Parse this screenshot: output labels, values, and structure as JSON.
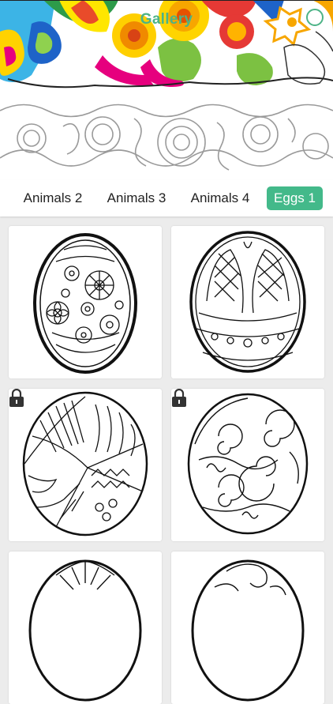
{
  "header": {
    "title": "Gallery"
  },
  "colors": {
    "accent": "#43b98a",
    "title_green": "#4db386"
  },
  "tabs": [
    {
      "label": "Animals 2",
      "active": false
    },
    {
      "label": "Animals 3",
      "active": false
    },
    {
      "label": "Animals 4",
      "active": false
    },
    {
      "label": "Eggs 1",
      "active": true
    }
  ],
  "cards": [
    {
      "pattern": "flowers",
      "locked": false
    },
    {
      "pattern": "lattice",
      "locked": false
    },
    {
      "pattern": "zentangle",
      "locked": true
    },
    {
      "pattern": "swirls",
      "locked": true
    },
    {
      "pattern": "feathers",
      "locked": false
    },
    {
      "pattern": "scrolls",
      "locked": false
    }
  ]
}
